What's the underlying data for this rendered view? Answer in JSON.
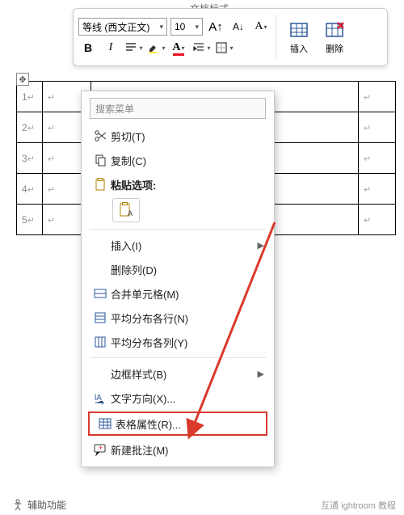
{
  "title_fragment": "文档标式",
  "ribbon": {
    "font_name": "等线 (西文正文)",
    "font_size": "10",
    "grow": "A↑",
    "shrink": "A↓",
    "clearfmt": "A",
    "bold": "B",
    "italic": "I",
    "insert_label": "插入",
    "delete_label": "删除"
  },
  "table": {
    "rows": [
      "1",
      "2",
      "3",
      "4",
      "5"
    ],
    "cell_mark": "↵"
  },
  "menu": {
    "search_placeholder": "搜索菜单",
    "cut": "剪切(T)",
    "copy": "复制(C)",
    "paste_label": "粘贴选项:",
    "insert": "插入(I)",
    "delete_col": "删除列(D)",
    "merge": "合并单元格(M)",
    "dist_rows": "平均分布各行(N)",
    "dist_cols": "平均分布各列(Y)",
    "border_style": "边框样式(B)",
    "text_dir": "文字方向(X)...",
    "table_props": "表格属性(R)...",
    "new_comment": "新建批注(M)"
  },
  "footer": {
    "a11y": "辅助功能"
  },
  "watermark": "互通 ightroom 教程"
}
